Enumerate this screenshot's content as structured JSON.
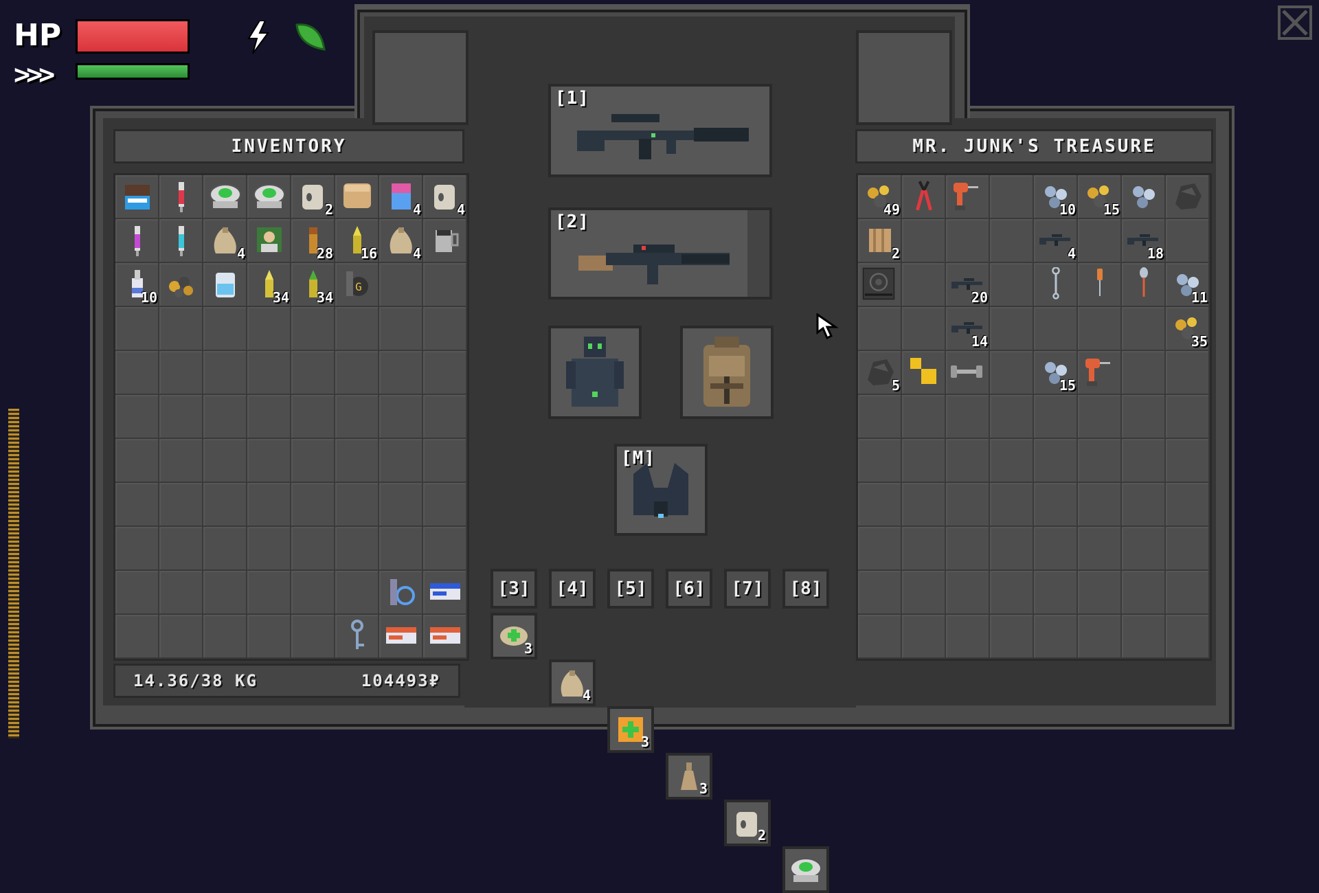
{
  "hud": {
    "hp_label": "HP",
    "hp_fraction": 1.0,
    "stamina_label": ">>>",
    "stamina_fraction": 1.0,
    "status_icons": [
      "bolt-icon",
      "leaf-icon"
    ]
  },
  "inventory": {
    "title": "INVENTORY",
    "weight": "14.36/38 KG",
    "money": "104493₽",
    "items": [
      {
        "icon": "chocolate-bar-icon",
        "count": ""
      },
      {
        "icon": "red-syringe-icon",
        "count": ""
      },
      {
        "icon": "medkit-eye-icon",
        "count": ""
      },
      {
        "icon": "medkit-eye-icon",
        "count": ""
      },
      {
        "icon": "toilet-paper-icon",
        "count": "2"
      },
      {
        "icon": "bread-icon",
        "count": ""
      },
      {
        "icon": "pill-bottle-icon",
        "count": "4"
      },
      {
        "icon": "toilet-paper-icon",
        "count": "4"
      },
      {
        "icon": "purple-syringe-icon",
        "count": ""
      },
      {
        "icon": "cyan-syringe-icon",
        "count": ""
      },
      {
        "icon": "sack-icon",
        "count": "4"
      },
      {
        "icon": "photo-icon",
        "count": ""
      },
      {
        "icon": "cartridge-icon",
        "count": "28"
      },
      {
        "icon": "bullet-icon",
        "count": "16"
      },
      {
        "icon": "sack-icon",
        "count": "4"
      },
      {
        "icon": "mug-icon",
        "count": ""
      },
      {
        "icon": "bottle-icon",
        "count": "10"
      },
      {
        "icon": "scrap-icon",
        "count": ""
      },
      {
        "icon": "jar-icon",
        "count": ""
      },
      {
        "icon": "yellow-bullet-icon",
        "count": "34"
      },
      {
        "icon": "green-bullet-icon",
        "count": "34"
      },
      {
        "icon": "grenade-icon",
        "count": ""
      }
    ],
    "bottom_items": [
      "keyring-icon",
      "blue-keycard-icon",
      "key-icon",
      "orange-keycard-icon",
      "orange-keycard-icon"
    ]
  },
  "equipment": {
    "slot1_label": "[1]",
    "slot2_label": "[2]",
    "melee_label": "[M]",
    "hotbar": [
      {
        "label": "[3]",
        "icon": "medkit-icon",
        "count": "3"
      },
      {
        "label": "[4]",
        "icon": "sack-icon",
        "count": "4"
      },
      {
        "label": "[5]",
        "icon": "first-aid-icon",
        "count": "3"
      },
      {
        "label": "[6]",
        "icon": "flask-icon",
        "count": "3"
      },
      {
        "label": "[7]",
        "icon": "toilet-paper-icon",
        "count": "2"
      },
      {
        "label": "[8]",
        "icon": "medkit-eye-icon",
        "count": ""
      }
    ]
  },
  "store": {
    "title": "MR. JUNK'S TREASURE",
    "counts": {
      "gold_scrap": "49",
      "box": "2",
      "bolts1": "10",
      "gold2": "15",
      "rifle1": "4",
      "rifle2": "18",
      "rifle3": "20",
      "rifle4": "14",
      "bolts2": "11",
      "gold3": "35",
      "coal": "5",
      "bolts3": "15"
    }
  },
  "colors": {
    "hp": "#e0383e",
    "stamina": "#3aa843",
    "panel": "#363636",
    "cell": "#4e4e4e"
  }
}
